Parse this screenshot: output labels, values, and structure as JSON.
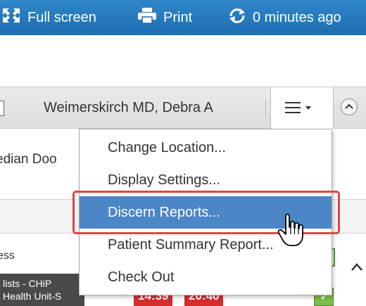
{
  "toolbar": {
    "fullscreen_label": "Full screen",
    "print_label": "Print",
    "refresh_label": "0 minutes ago",
    "background_color": "#1d6eb0"
  },
  "header": {
    "provider_name": "Weimerskirch MD, Debra A",
    "menu_icon": "hamburger-menu-icon"
  },
  "background": {
    "median_text": "edian Doo",
    "ess_text": "ess",
    "lists_line1": "lists - CHiP",
    "lists_line2": "Health Unit-S",
    "time1": "14:39",
    "time2": "20:40"
  },
  "dropdown": {
    "items": [
      {
        "label": "Change Location..."
      },
      {
        "label": "Display Settings..."
      },
      {
        "label": "Discern Reports...",
        "selected": true
      },
      {
        "label": "Patient Summary Report..."
      },
      {
        "label": "Check Out"
      }
    ],
    "highlight_color": "#4b86c7",
    "callout_color": "#e04545"
  }
}
